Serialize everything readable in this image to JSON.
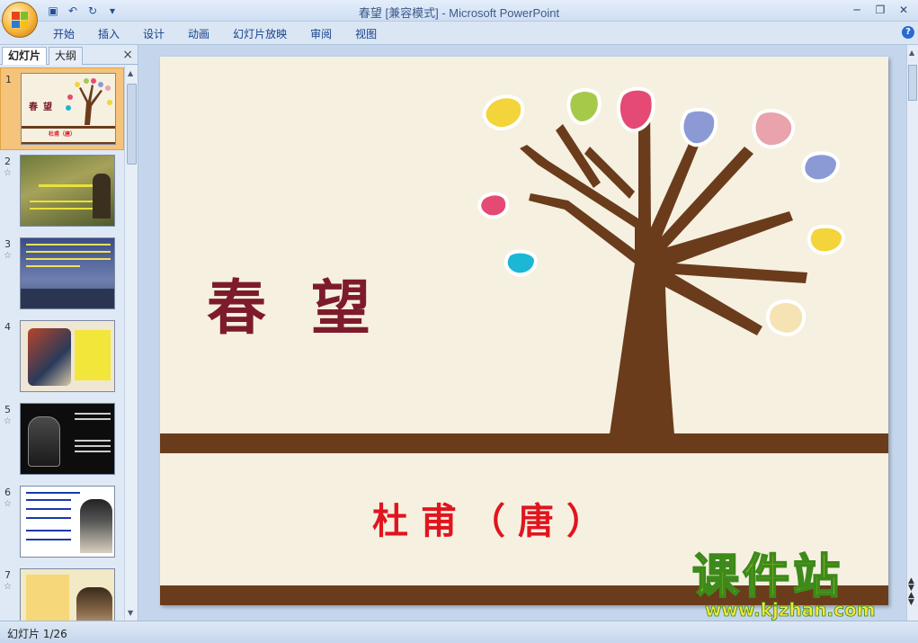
{
  "app": {
    "title": "春望 [兼容模式] - Microsoft PowerPoint"
  },
  "qat": {
    "save_icon": "save-icon",
    "undo_icon": "undo-icon",
    "redo_icon": "redo-icon",
    "customize_icon": "customize-icon"
  },
  "ribbon": {
    "tabs": [
      "开始",
      "插入",
      "设计",
      "动画",
      "幻灯片放映",
      "审阅",
      "视图"
    ]
  },
  "panel": {
    "tabs": [
      "幻灯片",
      "大纲"
    ],
    "close": "×"
  },
  "thumbnails": [
    {
      "num": "1",
      "star": ""
    },
    {
      "num": "2",
      "star": "☆"
    },
    {
      "num": "3",
      "star": "☆"
    },
    {
      "num": "4",
      "star": ""
    },
    {
      "num": "5",
      "star": "☆"
    },
    {
      "num": "6",
      "star": "☆"
    },
    {
      "num": "7",
      "star": "☆"
    }
  ],
  "slide": {
    "title": "春望",
    "subtitle": "杜甫（唐）"
  },
  "watermark": {
    "cn": "课件站",
    "url": "www.kjzhan.com"
  },
  "status": {
    "slide_counter": "幻灯片 1/26"
  },
  "colors": {
    "title": "#7d1b2c",
    "subtitle": "#e0151f",
    "trunk": "#6a3c1c",
    "background": "#f6f0e0"
  }
}
